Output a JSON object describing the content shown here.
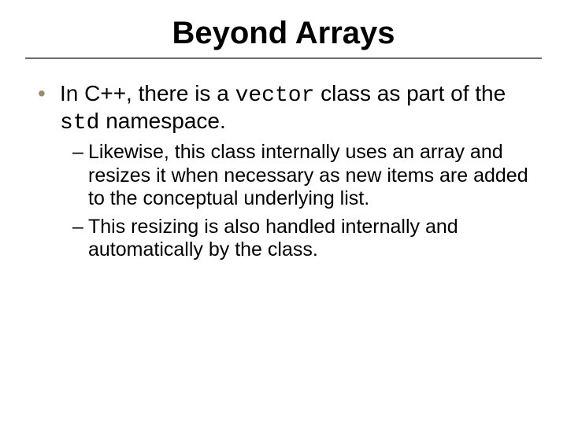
{
  "title": "Beyond Arrays",
  "bullets": [
    {
      "pre": "In C++, there is a ",
      "code1": "vector",
      "mid": " class as part of the ",
      "code2": "std",
      "post": " namespace.",
      "sub": [
        "Likewise, this class internally uses an array and resizes it when necessary as new items are added to the conceptual underlying list.",
        "This resizing is also handled internally and automatically by the class."
      ]
    }
  ]
}
